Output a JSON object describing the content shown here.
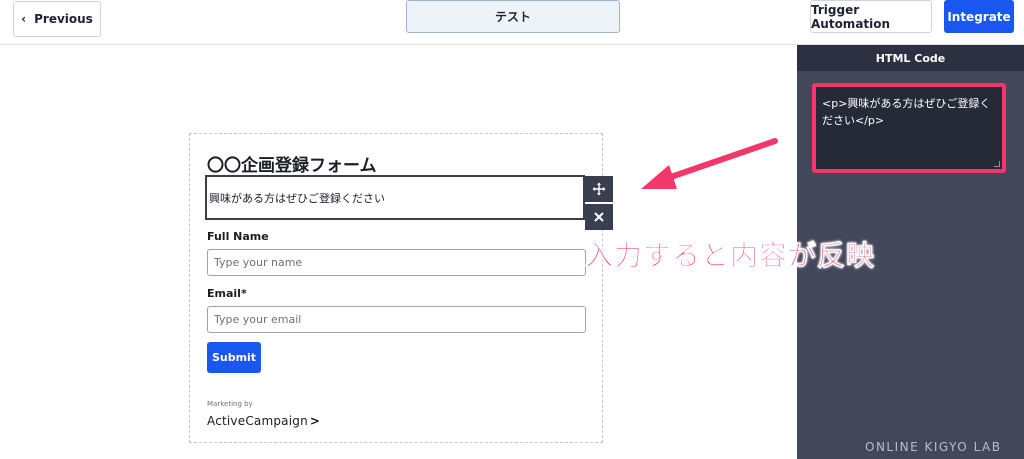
{
  "topbar": {
    "previous_label": "Previous",
    "previous_icon": "chevron-left-icon",
    "tab_label": "テスト",
    "trigger_label": "Trigger Automation",
    "integrate_label": "Integrate"
  },
  "side_panel": {
    "title": "HTML Code",
    "code": "<p>興味がある方はぜひご登録ください</p>"
  },
  "form": {
    "title": "〇〇企画登録フォーム",
    "paragraph": "興味がある方はぜひご登録ください",
    "move_icon": "move-icon",
    "close_icon": "close-icon",
    "name_label": "Full Name",
    "name_placeholder": "Type your name",
    "email_label": "Email*",
    "email_placeholder": "Type your email",
    "submit_label": "Submit",
    "marketing_label": "Marketing by",
    "brand": "ActiveCampaign",
    "brand_arrow": ">"
  },
  "annotation": {
    "text": "入力すると内容が反映",
    "color": "#f2386a"
  },
  "watermark": "ONLINE KIGYO LAB",
  "colors": {
    "accent": "#1a56f0",
    "panel": "#43475a",
    "highlight": "#f2386a"
  }
}
